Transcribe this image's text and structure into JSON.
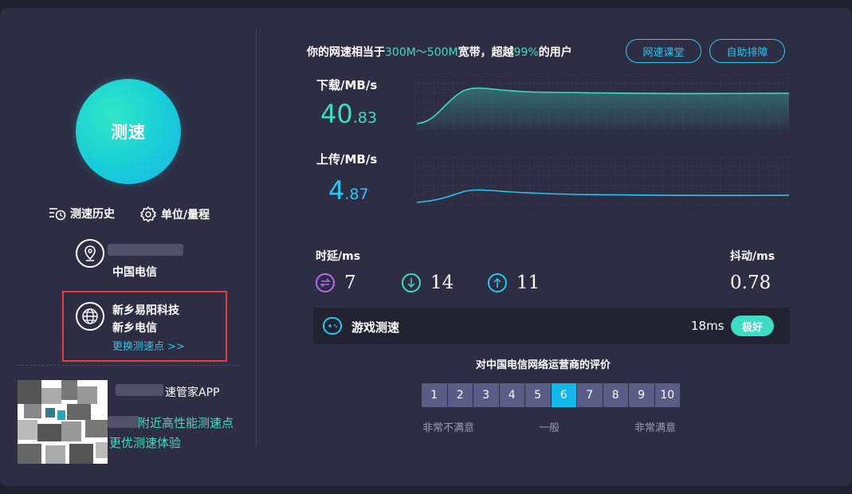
{
  "left": {
    "speed_button": "测速",
    "history_label": "测速历史",
    "unit_label": "单位/量程",
    "user_isp": "中国电信",
    "node_name": "新乡易阳科技",
    "node_isp": "新乡电信",
    "change_node": "更换测速点 >>",
    "app_text": "速管家APP",
    "promo_line1": "附近高性能测速点",
    "promo_line2": "更优测速体验"
  },
  "summary": {
    "prefix": "你的网速相当于",
    "bandwidth": "300M～500M",
    "middle": "宽带，超越",
    "percent": "99%",
    "suffix": "的用户"
  },
  "buttons": {
    "course": "网速课堂",
    "troubleshoot": "自助排障"
  },
  "download": {
    "label": "下载/MB/s",
    "int": "40",
    "dec": ".83",
    "value": 40.83
  },
  "upload": {
    "label": "上传/MB/s",
    "int": "4",
    "dec": ".87",
    "value": 4.87
  },
  "latency": {
    "label": "时延/ms",
    "values": [
      "7",
      "14",
      "11"
    ],
    "jitter_label": "抖动/ms",
    "jitter": "0.78"
  },
  "game": {
    "label": "游戏测速",
    "ms": "18ms",
    "badge": "极好"
  },
  "rating": {
    "title": "对中国电信网络运营商的评价",
    "options": [
      "1",
      "2",
      "3",
      "4",
      "5",
      "6",
      "7",
      "8",
      "9",
      "10"
    ],
    "selected": "6",
    "low": "非常不满意",
    "mid": "一般",
    "high": "非常满意"
  },
  "colors": {
    "accent_teal": "#3fdcc4",
    "accent_blue": "#27c8f0",
    "purple": "#b36cf0",
    "panel": "#2d2e44"
  }
}
